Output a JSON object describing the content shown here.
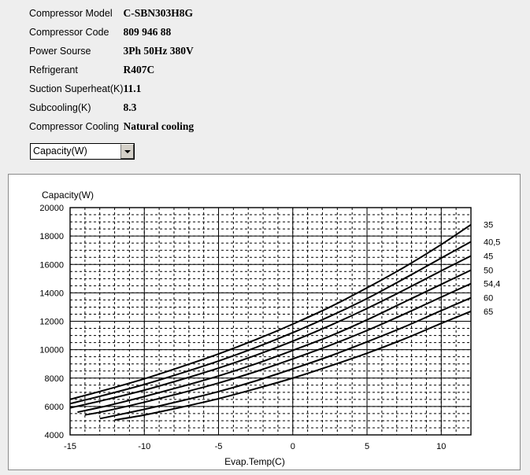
{
  "specs": {
    "rows": [
      {
        "label": "Compressor  Model",
        "value": "C-SBN303H8G"
      },
      {
        "label": "Compressor Code",
        "value": "809 946 88"
      },
      {
        "label": "Power Sourse",
        "value": "3Ph  50Hz  380V"
      },
      {
        "label": "Refrigerant",
        "value": "R407C"
      },
      {
        "label": "Suction Superheat(K)",
        "value": "11.1"
      },
      {
        "label": "Subcooling(K)",
        "value": "8.3"
      },
      {
        "label": "Compressor Cooling",
        "value": "Natural cooling"
      }
    ]
  },
  "selector": {
    "value": "Capacity(W)",
    "icon": "chevron-down-icon",
    "options": [
      "Capacity(W)"
    ]
  },
  "chart_data": {
    "type": "line",
    "title": "",
    "xlabel": "Evap.Temp(C)",
    "ylabel": "Capacity(W)",
    "xlim": [
      -15,
      12
    ],
    "ylim": [
      4000,
      20000
    ],
    "xticks": [
      -15,
      -10,
      -5,
      0,
      5,
      10
    ],
    "yticks": [
      4000,
      6000,
      8000,
      10000,
      12000,
      14000,
      16000,
      18000,
      20000
    ],
    "xtick_labels": [
      "-15",
      "-10",
      "-5",
      "0",
      "5",
      "10"
    ],
    "ytick_labels": [
      "4000",
      "6000",
      "8000",
      "10000",
      "12000",
      "14000",
      "16000",
      "18000",
      "20000"
    ],
    "x_minor_step": 1,
    "y_minor_step": 500,
    "grid": true,
    "grid_major_style": "solid",
    "grid_minor_style": "dashed",
    "legend_position": "right",
    "legend_title": "",
    "series": [
      {
        "name": "35",
        "x": [
          -15,
          -12.5,
          -10,
          -7.5,
          -5,
          -2.5,
          0,
          2.5,
          5,
          7.5,
          10,
          12
        ],
        "values": [
          6500,
          7200,
          7950,
          8800,
          9700,
          10700,
          11800,
          13000,
          14350,
          15800,
          17400,
          18800
        ]
      },
      {
        "name": "40,5",
        "x": [
          -15,
          -12.5,
          -10,
          -7.5,
          -5,
          -2.5,
          0,
          2.5,
          5,
          7.5,
          10,
          12
        ],
        "values": [
          6200,
          6850,
          7550,
          8350,
          9200,
          10150,
          11200,
          12350,
          13600,
          15000,
          16450,
          17600
        ]
      },
      {
        "name": "45",
        "x": [
          -15,
          -12.5,
          -10,
          -7.5,
          -5,
          -2.5,
          0,
          2.5,
          5,
          7.5,
          10,
          12
        ],
        "values": [
          5900,
          6500,
          7150,
          7900,
          8700,
          9600,
          10600,
          11700,
          12900,
          14200,
          15550,
          16600
        ]
      },
      {
        "name": "50",
        "x": [
          -14.5,
          -12.5,
          -10,
          -7.5,
          -5,
          -2.5,
          0,
          2.5,
          5,
          7.5,
          10,
          12
        ],
        "values": [
          5600,
          6050,
          6700,
          7400,
          8150,
          9000,
          9950,
          10950,
          12100,
          13350,
          14600,
          15600
        ]
      },
      {
        "name": "54,4",
        "x": [
          -14,
          -12.5,
          -10,
          -7.5,
          -5,
          -2.5,
          0,
          2.5,
          5,
          7.5,
          10,
          12
        ],
        "values": [
          5400,
          5700,
          6300,
          6950,
          7650,
          8450,
          9350,
          10300,
          11350,
          12500,
          13700,
          14650
        ]
      },
      {
        "name": "60",
        "x": [
          -13,
          -12.5,
          -10,
          -7.5,
          -5,
          -2.5,
          0,
          2.5,
          5,
          7.5,
          10,
          12
        ],
        "values": [
          5150,
          5250,
          5800,
          6400,
          7050,
          7800,
          8650,
          9550,
          10550,
          11600,
          12750,
          13650
        ]
      },
      {
        "name": "65",
        "x": [
          -12,
          -10,
          -7.5,
          -5,
          -2.5,
          0,
          2.5,
          5,
          7.5,
          10,
          12
        ],
        "values": [
          5050,
          5400,
          5950,
          6550,
          7250,
          8000,
          8850,
          9750,
          10750,
          11850,
          12700
        ]
      }
    ]
  }
}
